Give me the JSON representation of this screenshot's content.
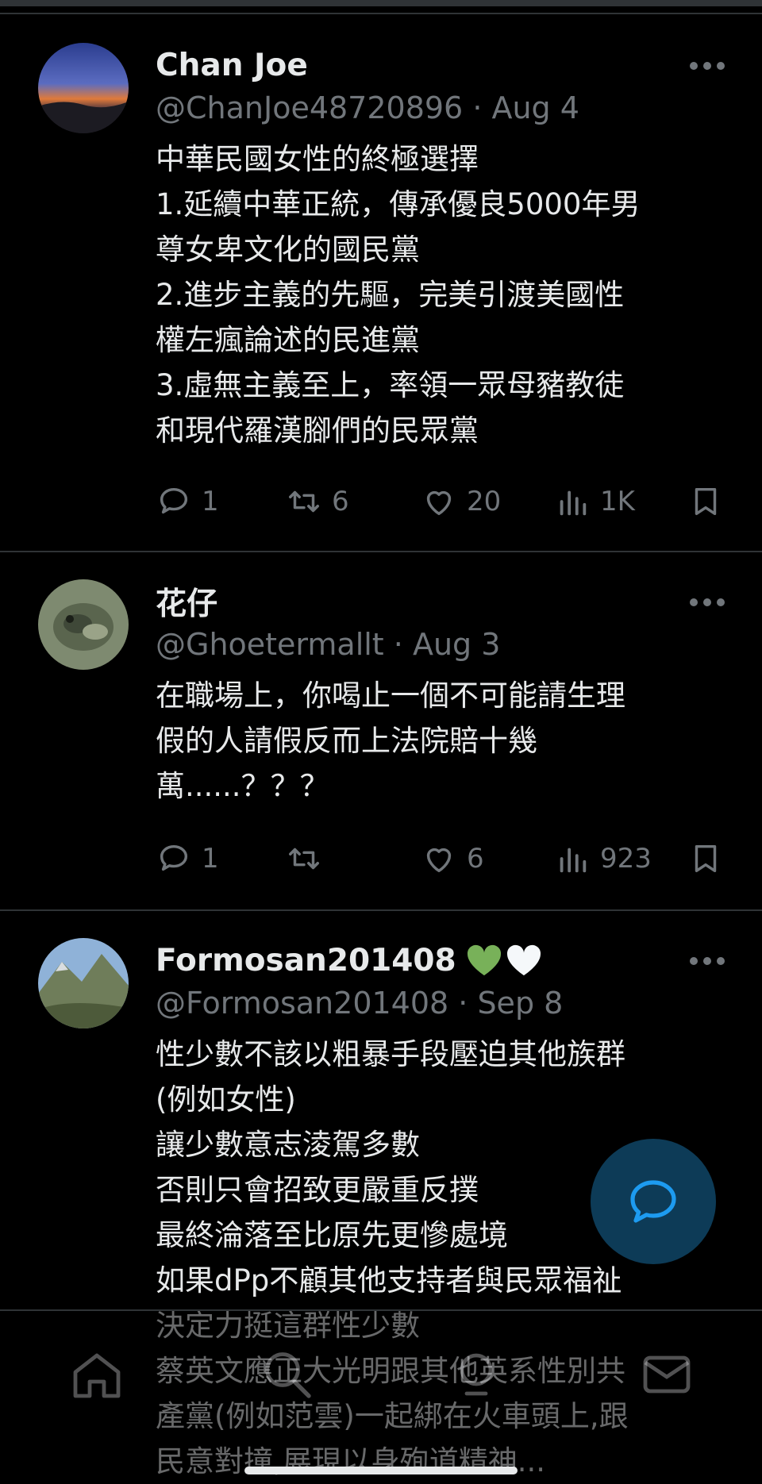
{
  "tweets": [
    {
      "display_name": "Chan Joe",
      "handle_date": "@ChanJoe48720896 · Aug 4",
      "body": "中華民國女性的終極選擇\n1.延續中華正統，傳承優良5000年男\n尊女卑文化的國民黨\n2.進步主義的先驅，完美引渡美國性\n權左瘋論述的民進黨\n3.虛無主義至上，率領一眾母豬教徒\n和現代羅漢腳們的民眾黨",
      "replies": "1",
      "retweets": "6",
      "likes": "20",
      "views": "1K"
    },
    {
      "display_name": "花仔",
      "handle_date": "@Ghoetermallt · Aug 3",
      "body": "在職場上，你喝止一個不可能請生理\n假的人請假反而上法院賠十幾\n萬......？？？",
      "replies": "1",
      "retweets": "",
      "likes": "6",
      "views": "923"
    },
    {
      "display_name": "Formosan201408",
      "badges": [
        "green-heart-icon",
        "white-heart-icon"
      ],
      "handle_date": "@Formosan201408 · Sep 8",
      "body": "性少數不該以粗暴手段壓迫其他族群\n(例如女性)\n讓少數意志淩駕多數\n否則只會招致更嚴重反撲\n最終淪落至比原先更慘處境\n如果dPp不顧其他支持者與民眾福祉\n決定力挺這群性少數\n蔡英文應正大光明跟其他英系性別共\n產黨(例如范雲)一起綁在火車頭上,跟\n民意對撞,展現以身殉道精神..."
    }
  ],
  "icons": {
    "more": "more-icon",
    "reply": "reply-icon",
    "retweet": "retweet-icon",
    "like": "like-icon",
    "views": "views-icon",
    "bookmark": "bookmark-icon",
    "fab": "compose-message-icon",
    "nav": [
      "home-icon",
      "search-icon",
      "spaces-icon",
      "messages-icon"
    ]
  },
  "colors": {
    "background": "#000000",
    "text": "#e7e9ea",
    "secondary_text": "#71767b",
    "divider": "#2f3336",
    "fab": "#0d3b57",
    "fab_icon": "#1d9bf0",
    "green_heart": "#78b159"
  }
}
